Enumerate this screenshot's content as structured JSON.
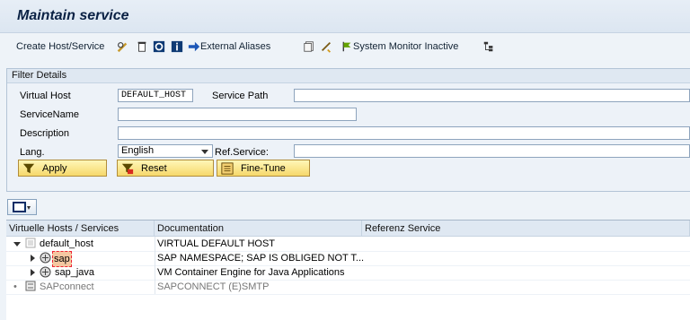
{
  "title": "Maintain service",
  "toolbar": {
    "create_host_service": "Create Host/Service",
    "external_aliases": "External Aliases",
    "system_monitor": "System Monitor Inactive"
  },
  "filter": {
    "header": "Filter Details",
    "virtual_host_label": "Virtual Host",
    "virtual_host_value": "DEFAULT_HOST",
    "service_path_label": "Service Path",
    "service_name_label": "ServiceName",
    "description_label": "Description",
    "lang_label": "Lang.",
    "lang_value": "English",
    "ref_service_label": "Ref.Service:",
    "apply": "Apply",
    "reset": "Reset",
    "fine_tune": "Fine-Tune"
  },
  "tree": {
    "columns": [
      "Virtuelle Hosts / Services",
      "Documentation",
      "Referenz Service"
    ],
    "rows": [
      {
        "name": "default_host",
        "doc": "VIRTUAL DEFAULT HOST"
      },
      {
        "name": "sap",
        "doc": "SAP NAMESPACE; SAP IS OBLIGED NOT T..."
      },
      {
        "name": "sap_java",
        "doc": "VM Container Engine for Java Applications"
      },
      {
        "name": "SAPconnect",
        "doc": "SAPCONNECT (E)SMTP"
      }
    ]
  },
  "colors": {
    "accent": "#0a2144",
    "button": "#f6d86b",
    "panel": "#eef3f8"
  },
  "icons": [
    "pencil-glasses-icon",
    "trash-icon",
    "refresh-icon",
    "info-icon",
    "arrow-right-icon",
    "copy-icon",
    "tools-icon",
    "flag-icon",
    "hierarchy-icon",
    "filter-icon",
    "reset-icon",
    "fine-tune-icon",
    "print-icon",
    "host-icon",
    "service-icon",
    "sapconnect-icon"
  ]
}
